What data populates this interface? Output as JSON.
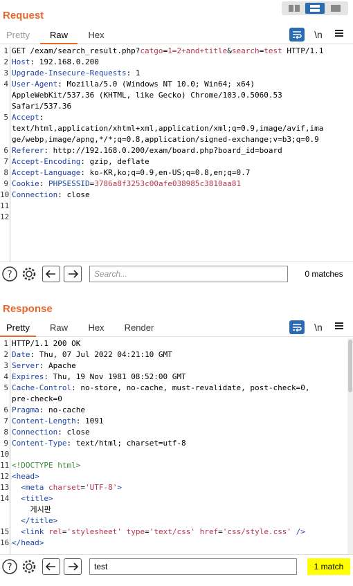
{
  "request": {
    "title": "Request",
    "tabs": [
      {
        "label": "Pretty"
      },
      {
        "label": "Raw"
      },
      {
        "label": "Hex"
      }
    ],
    "active_tab": "Raw",
    "newline_label": "\\n",
    "menu_icon": "hamburger-icon",
    "search": {
      "placeholder": "Search...",
      "value": "",
      "matches": "0 matches"
    },
    "lines": [
      {
        "n": "1",
        "parts": [
          [
            "hv",
            "GET /exam/search_result.php?"
          ],
          [
            "pu",
            "catgo"
          ],
          [
            "hv",
            "="
          ],
          [
            "pu",
            "1=2+and+title"
          ],
          [
            "hv",
            "&"
          ],
          [
            "pu",
            "search"
          ],
          [
            "hv",
            "="
          ],
          [
            "pu",
            "test"
          ],
          [
            "hv",
            " HTTP/1.1"
          ]
        ]
      },
      {
        "n": "2",
        "parts": [
          [
            "hk",
            "Host"
          ],
          [
            "hv",
            ": 192.168.0.200"
          ]
        ]
      },
      {
        "n": "3",
        "parts": [
          [
            "hk",
            "Upgrade-Insecure-Requests"
          ],
          [
            "hv",
            ": 1"
          ]
        ]
      },
      {
        "n": "4",
        "parts": [
          [
            "hk",
            "User-Agent"
          ],
          [
            "hv",
            ": Mozilla/5.0 (Windows NT 10.0; Win64; x64)"
          ]
        ]
      },
      {
        "n": "",
        "parts": [
          [
            "hv",
            "AppleWebKit/537.36 (KHTML, like Gecko) Chrome/103.0.5060.53"
          ]
        ]
      },
      {
        "n": "",
        "parts": [
          [
            "hv",
            "Safari/537.36"
          ]
        ]
      },
      {
        "n": "5",
        "parts": [
          [
            "hk",
            "Accept"
          ],
          [
            "hv",
            ":"
          ]
        ]
      },
      {
        "n": "",
        "parts": [
          [
            "hv",
            "text/html,application/xhtml+xml,application/xml;q=0.9,image/avif,ima"
          ]
        ]
      },
      {
        "n": "",
        "parts": [
          [
            "hv",
            "ge/webp,image/apng,*/*;q=0.8,application/signed-exchange;v=b3;q=0.9"
          ]
        ]
      },
      {
        "n": "6",
        "parts": [
          [
            "hk",
            "Referer"
          ],
          [
            "hv",
            ": http://192.168.0.200/exam/board.php?board_id=board"
          ]
        ]
      },
      {
        "n": "7",
        "parts": [
          [
            "hk",
            "Accept-Encoding"
          ],
          [
            "hv",
            ": gzip, deflate"
          ]
        ]
      },
      {
        "n": "8",
        "parts": [
          [
            "hk",
            "Accept-Language"
          ],
          [
            "hv",
            ": ko-KR,ko;q=0.9,en-US;q=0.8,en;q=0.7"
          ]
        ]
      },
      {
        "n": "9",
        "parts": [
          [
            "hk",
            "Cookie"
          ],
          [
            "hv",
            ": "
          ],
          [
            "hk",
            "PHPSESSID"
          ],
          [
            "hv",
            "="
          ],
          [
            "ck",
            "3786a8f3253c00afe038985c3810aa81"
          ]
        ]
      },
      {
        "n": "10",
        "parts": [
          [
            "hk",
            "Connection"
          ],
          [
            "hv",
            ": close"
          ]
        ]
      },
      {
        "n": "11",
        "parts": [
          [
            "hv",
            ""
          ]
        ]
      },
      {
        "n": "12",
        "parts": [
          [
            "hv",
            ""
          ]
        ]
      }
    ]
  },
  "response": {
    "title": "Response",
    "tabs": [
      {
        "label": "Pretty"
      },
      {
        "label": "Raw"
      },
      {
        "label": "Hex"
      },
      {
        "label": "Render"
      }
    ],
    "active_tab": "Pretty",
    "newline_label": "\\n",
    "search": {
      "placeholder": "",
      "value": "test",
      "matches": "1 match",
      "match_bg": "#ffff00"
    },
    "lines": [
      {
        "n": "1",
        "parts": [
          [
            "hv",
            "HTTP/1.1 200 OK"
          ]
        ]
      },
      {
        "n": "2",
        "parts": [
          [
            "hk",
            "Date"
          ],
          [
            "hv",
            ": Thu, 07 Jul 2022 04:21:10 GMT"
          ]
        ]
      },
      {
        "n": "3",
        "parts": [
          [
            "hk",
            "Server"
          ],
          [
            "hv",
            ": Apache"
          ]
        ]
      },
      {
        "n": "4",
        "parts": [
          [
            "hk",
            "Expires"
          ],
          [
            "hv",
            ": Thu, 19 Nov 1981 08:52:00 GMT"
          ]
        ]
      },
      {
        "n": "5",
        "parts": [
          [
            "hk",
            "Cache-Control"
          ],
          [
            "hv",
            ": no-store, no-cache, must-revalidate, post-check=0,"
          ]
        ]
      },
      {
        "n": "",
        "parts": [
          [
            "hv",
            "pre-check=0"
          ]
        ]
      },
      {
        "n": "6",
        "parts": [
          [
            "hk",
            "Pragma"
          ],
          [
            "hv",
            ": no-cache"
          ]
        ]
      },
      {
        "n": "7",
        "parts": [
          [
            "hk",
            "Content-Length"
          ],
          [
            "hv",
            ": 1091"
          ]
        ]
      },
      {
        "n": "8",
        "parts": [
          [
            "hk",
            "Connection"
          ],
          [
            "hv",
            ": close"
          ]
        ]
      },
      {
        "n": "9",
        "parts": [
          [
            "hk",
            "Content-Type"
          ],
          [
            "hv",
            ": text/html; charset=utf-8"
          ]
        ]
      },
      {
        "n": "10",
        "parts": [
          [
            "hv",
            ""
          ]
        ]
      },
      {
        "n": "11",
        "parts": [
          [
            "cm",
            "<!DOCTYPE html>"
          ]
        ]
      },
      {
        "n": "12",
        "parts": [
          [
            "tg",
            "<head>"
          ]
        ]
      },
      {
        "n": "13",
        "parts": [
          [
            "hv",
            "  "
          ],
          [
            "tg",
            "<meta "
          ],
          [
            "at",
            "charset"
          ],
          [
            "hv",
            "="
          ],
          [
            "av",
            "'UTF-8'"
          ],
          [
            "tg",
            ">"
          ]
        ]
      },
      {
        "n": "14",
        "parts": [
          [
            "hv",
            "  "
          ],
          [
            "tg",
            "<title>"
          ]
        ]
      },
      {
        "n": "",
        "parts": [
          [
            "hv",
            "    게시판"
          ]
        ]
      },
      {
        "n": "",
        "parts": [
          [
            "hv",
            "  "
          ],
          [
            "tg",
            "</title>"
          ]
        ]
      },
      {
        "n": "15",
        "parts": [
          [
            "hv",
            "  "
          ],
          [
            "tg",
            "<link "
          ],
          [
            "at",
            "rel"
          ],
          [
            "hv",
            "="
          ],
          [
            "av",
            "'stylesheet'"
          ],
          [
            "hv",
            " "
          ],
          [
            "at",
            "type"
          ],
          [
            "hv",
            "="
          ],
          [
            "av",
            "'text/css'"
          ],
          [
            "hv",
            " "
          ],
          [
            "at",
            "href"
          ],
          [
            "hv",
            "="
          ],
          [
            "av",
            "'css/style.css'"
          ],
          [
            "hv",
            " "
          ],
          [
            "tg",
            "/>"
          ]
        ]
      },
      {
        "n": "16",
        "parts": [
          [
            "tg",
            "</head>"
          ]
        ]
      }
    ]
  },
  "colors": {
    "accent": "#e8672c",
    "wrap_button": "#2b6cb0",
    "header_key": "#1b43a4",
    "param": "#b5344b"
  }
}
